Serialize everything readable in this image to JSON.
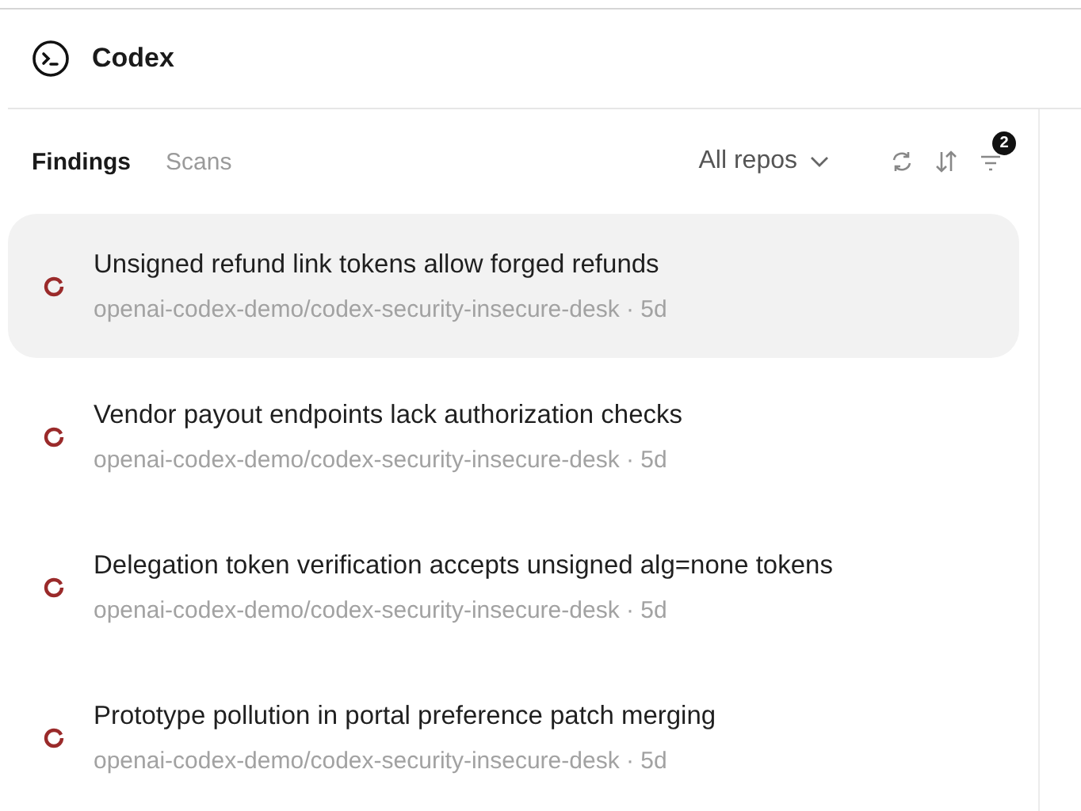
{
  "header": {
    "title": "Codex"
  },
  "tabs": [
    {
      "label": "Findings",
      "selected": true
    },
    {
      "label": "Scans",
      "selected": false
    }
  ],
  "toolbar": {
    "repo_filter": "All repos",
    "filter_badge": "2"
  },
  "findings": [
    {
      "title": "Unsigned refund link tokens allow forged refunds",
      "meta": "openai-codex-demo/codex-security-insecure-desk · 5d",
      "selected": true
    },
    {
      "title": "Vendor payout endpoints lack authorization checks",
      "meta": "openai-codex-demo/codex-security-insecure-desk · 5d",
      "selected": false
    },
    {
      "title": "Delegation token verification accepts unsigned alg=none tokens",
      "meta": "openai-codex-demo/codex-security-insecure-desk · 5d",
      "selected": false
    },
    {
      "title": "Prototype pollution in portal preference patch merging",
      "meta": "openai-codex-demo/codex-security-insecure-desk · 5d",
      "selected": false
    }
  ]
}
